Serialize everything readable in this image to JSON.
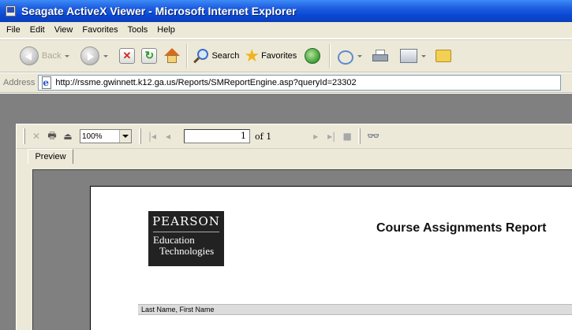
{
  "window": {
    "title": "Seagate ActiveX Viewer - Microsoft Internet Explorer"
  },
  "menu": {
    "items": [
      "File",
      "Edit",
      "View",
      "Favorites",
      "Tools",
      "Help"
    ]
  },
  "toolbar": {
    "back_label": "Back",
    "search_label": "Search",
    "favorites_label": "Favorites"
  },
  "address": {
    "label": "Address",
    "url": "http://rssme.gwinnett.k12.ga.us/Reports/SMReportEngine.asp?queryId=23302"
  },
  "viewer": {
    "zoom": "100%",
    "page_current": "1",
    "page_total_label": "of 1",
    "tab_label": "Preview"
  },
  "report": {
    "logo_name": "PEARSON",
    "logo_line1": "Education",
    "logo_line2": "Technologies",
    "title": "Course Assignments Report",
    "column_header": "Last Name, First Name"
  },
  "colors": {
    "titlebar": "#0a48d4",
    "chrome": "#ece9d8",
    "content_bg": "#808080"
  }
}
